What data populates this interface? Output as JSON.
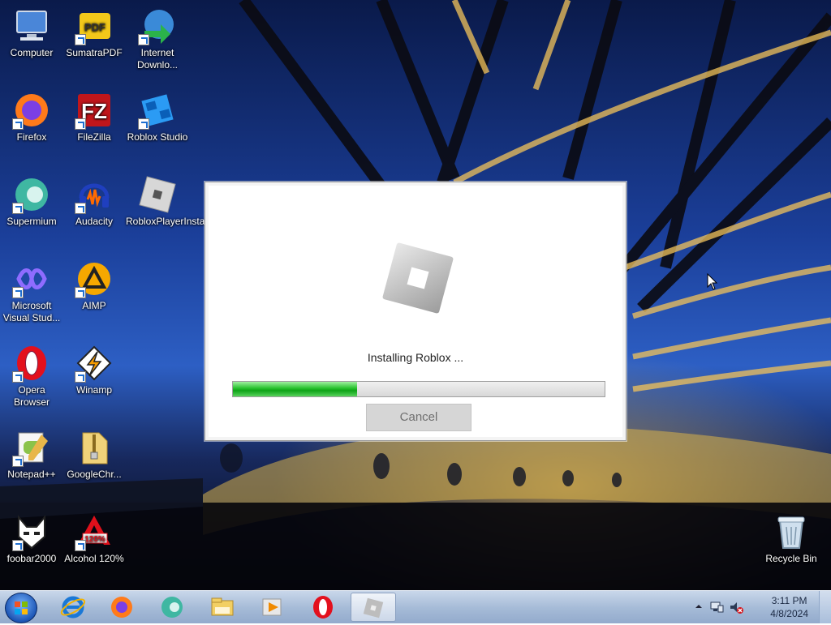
{
  "desktop": {
    "icons": [
      {
        "label": "Computer",
        "icon": "computer-icon"
      },
      {
        "label": "SumatraPDF",
        "icon": "pdf-icon"
      },
      {
        "label": "Internet Downlo...",
        "icon": "download-manager-icon"
      },
      {
        "label": "Firefox",
        "icon": "firefox-icon"
      },
      {
        "label": "FileZilla",
        "icon": "filezilla-icon"
      },
      {
        "label": "Roblox Studio",
        "icon": "roblox-studio-icon"
      },
      {
        "label": "Supermium",
        "icon": "supermium-icon"
      },
      {
        "label": "Audacity",
        "icon": "audacity-icon"
      },
      {
        "label": "RobloxPlayerInstaller",
        "icon": "roblox-installer-icon"
      },
      {
        "label": "Microsoft Visual Stud...",
        "icon": "visual-studio-icon"
      },
      {
        "label": "AIMP",
        "icon": "aimp-icon"
      },
      {
        "label": "Opera Browser",
        "icon": "opera-icon"
      },
      {
        "label": "Winamp",
        "icon": "winamp-icon"
      },
      {
        "label": "Notepad++",
        "icon": "notepad-plus-plus-icon"
      },
      {
        "label": "GoogleChr...",
        "icon": "zip-folder-icon"
      },
      {
        "label": "foobar2000",
        "icon": "foobar2000-icon"
      },
      {
        "label": "Alcohol 120%",
        "icon": "alcohol-120-icon"
      },
      {
        "label": "Recycle Bin",
        "icon": "recycle-bin-icon"
      }
    ]
  },
  "installer": {
    "status_text": "Installing Roblox ...",
    "progress": 0.335,
    "cancel_label": "Cancel"
  },
  "taskbar": {
    "items": [
      "internet-explorer-icon",
      "firefox-icon",
      "supermium-icon",
      "file-explorer-icon",
      "media-player-icon",
      "opera-icon",
      "roblox-installer-icon"
    ],
    "clock_time": "3:11 PM",
    "clock_date": "4/8/2024"
  },
  "colors": {
    "progress_green": "#25c02c",
    "taskbar": "#a7bcd8"
  }
}
